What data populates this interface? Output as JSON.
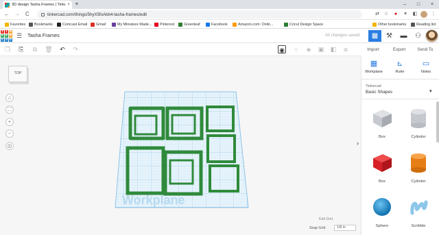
{
  "browser": {
    "tab_title": "3D design Tasha Frames | Tinke...",
    "tab_close": "×",
    "new_tab": "+",
    "window_controls": [
      "–",
      "□",
      "×"
    ],
    "url": "tinkercad.com/things/5hyX5foAkb4-tasha-frames/edit",
    "nav": [
      "←",
      "→",
      "C"
    ],
    "bookmarks": [
      {
        "label": "Favorites",
        "color": "#f4b400"
      },
      {
        "label": "Bookmarks",
        "color": "#555555"
      },
      {
        "label": "Comcast Email",
        "color": "#222222"
      },
      {
        "label": "Gmail",
        "color": "#d93025"
      },
      {
        "label": "My Miniature Made...",
        "color": "#6b3fa0"
      },
      {
        "label": "Pinterest",
        "color": "#e60023"
      },
      {
        "label": "Greenleaf",
        "color": "#2e7d32"
      },
      {
        "label": "Facebook",
        "color": "#1877f2"
      },
      {
        "label": "Amazon.com: Onlin...",
        "color": "#ff9900"
      },
      {
        "label": "Cricut Design Space",
        "color": "#2e7d32"
      },
      {
        "label": "Other bookmarks",
        "color": "#f4b400"
      },
      {
        "label": "Reading list",
        "color": "#555555"
      }
    ]
  },
  "app": {
    "logo_letters": [
      "T",
      "I",
      "N",
      "K",
      "E",
      "R",
      "C",
      "A",
      "D"
    ],
    "design_title": "Tasha Frames",
    "save_status": "All changes saved"
  },
  "toolbar": {
    "import": "Import",
    "export": "Export",
    "send_to": "Send To"
  },
  "canvas": {
    "viewcube_label": "TOP",
    "workplane_label": "Workplane",
    "edit_grid": "Edit Grid",
    "snap_grid_label": "Snap Grid",
    "snap_grid_value": "1/8 in"
  },
  "panel": {
    "tabs": [
      {
        "label": "Workplane",
        "icon": "workplane-icon"
      },
      {
        "label": "Ruler",
        "icon": "ruler-icon"
      },
      {
        "label": "Notes",
        "icon": "notes-icon"
      }
    ],
    "source_label": "Tinkercad",
    "source_value": "Basic Shapes",
    "shapes": [
      {
        "label": "Box",
        "icon": "box-striped-icon"
      },
      {
        "label": "Cylinder",
        "icon": "cylinder-striped-icon"
      },
      {
        "label": "Box",
        "icon": "box-red-icon"
      },
      {
        "label": "Cylinder",
        "icon": "cylinder-orange-icon"
      },
      {
        "label": "Sphere",
        "icon": "sphere-blue-icon"
      },
      {
        "label": "Scribble",
        "icon": "scribble-icon"
      }
    ]
  },
  "colors": {
    "accent": "#2a7de1",
    "frame_green": "#2f8a3b",
    "grid_blue": "#a9d3ee"
  }
}
